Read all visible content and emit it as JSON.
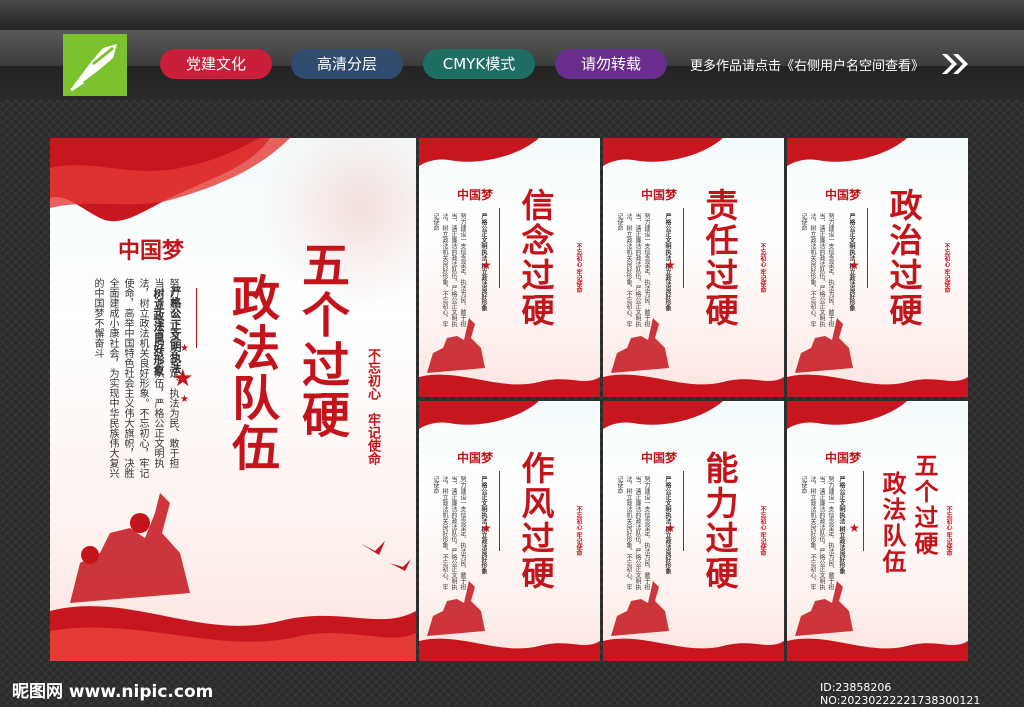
{
  "header": {
    "tags": [
      "党建文化",
      "高清分层",
      "CMYK模式",
      "请勿转载"
    ],
    "more_text": "更多作品请点击《右侧用户名空间查看》"
  },
  "main_poster": {
    "title_col1": "五个过硬",
    "title_col2": "政法队伍",
    "slogan_col1": "严格公正文明执法",
    "slogan_col2": "树立政法良好形象",
    "red_slogan_1": "不忘初心",
    "red_slogan_2": "牢记使命",
    "dream_text": "中国梦",
    "body_text": "努力建设一支信念坚定、执法为民、敢于担当、清正廉洁的政法队伍，严格公正文明执法，树立政法机关良好形象。不忘初心，牢记使命，高举中国特色社会主义伟大旗帜，决胜全面建成小康社会，为实现中华民族伟大复兴的中国梦不懈奋斗"
  },
  "small_posters": [
    {
      "title": "信念过硬"
    },
    {
      "title": "责任过硬"
    },
    {
      "title": "政治过硬"
    },
    {
      "title": "作风过硬"
    },
    {
      "title": "能力过硬"
    },
    {
      "title_col1": "五个过硬",
      "title_col2": "政法队伍"
    }
  ],
  "small_common": {
    "slogan": "严格公正文明执法 树立政法良好形象",
    "red_slogan": "不忘初心 牢记使命",
    "dream_text": "中国梦",
    "body_text": "努力建设一支信念坚定、执法为民、敢于担当、清正廉洁的政法队伍，严格公正文明执法，树立政法机关良好形象，不忘初心，牢记使命"
  },
  "footer": {
    "site": "昵图网 www.nipic.com",
    "id_text": "ID:23858206 NO:20230222221738300121"
  }
}
